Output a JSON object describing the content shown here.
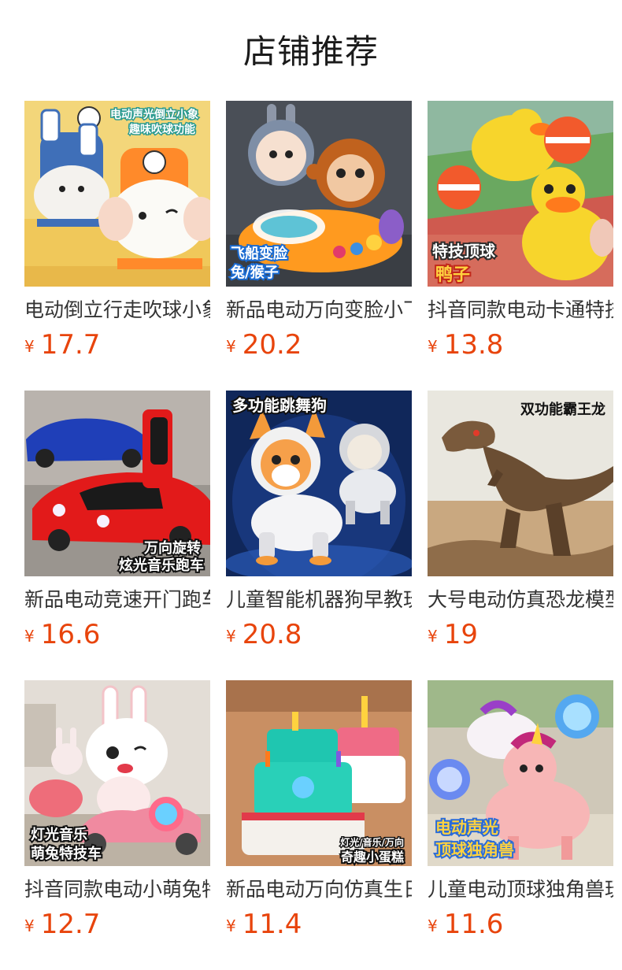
{
  "header": {
    "title": "店铺推荐"
  },
  "currency_symbol": "¥",
  "products": [
    {
      "name": "电动倒立行走吹球小象",
      "price": "17.7",
      "image_caption_lines": [
        "电动声光倒立小象",
        "趣味吹球功能"
      ]
    },
    {
      "name": "新品电动万向变脸小飞船",
      "price": "20.2",
      "image_caption_lines": [
        "飞船变脸",
        "兔/猴子"
      ]
    },
    {
      "name": "抖音同款电动卡通特技顶球鸭子",
      "price": "13.8",
      "image_caption_lines": [
        "特技顶球",
        "鸭子"
      ]
    },
    {
      "name": "新品电动竞速开门跑车",
      "price": "16.6",
      "image_caption_lines": [
        "万向旋转",
        "炫光音乐跑车"
      ]
    },
    {
      "name": "儿童智能机器狗早教玩具",
      "price": "20.8",
      "image_caption_lines": [
        "多功能跳舞狗"
      ]
    },
    {
      "name": "大号电动仿真恐龙模型",
      "price": "19",
      "image_caption_lines": [
        "双功能霸王龙"
      ]
    },
    {
      "name": "抖音同款电动小萌兔特技车",
      "price": "12.7",
      "image_caption_lines": [
        "灯光音乐",
        "萌兔特技车"
      ]
    },
    {
      "name": "新品电动万向仿真生日蛋糕",
      "price": "11.4",
      "image_caption_lines": [
        "灯光/音乐/万向",
        "奇趣小蛋糕"
      ]
    },
    {
      "name": "儿童电动顶球独角兽玩具",
      "price": "11.6",
      "image_caption_lines": [
        "电动声光",
        "顶球独角兽"
      ]
    }
  ]
}
